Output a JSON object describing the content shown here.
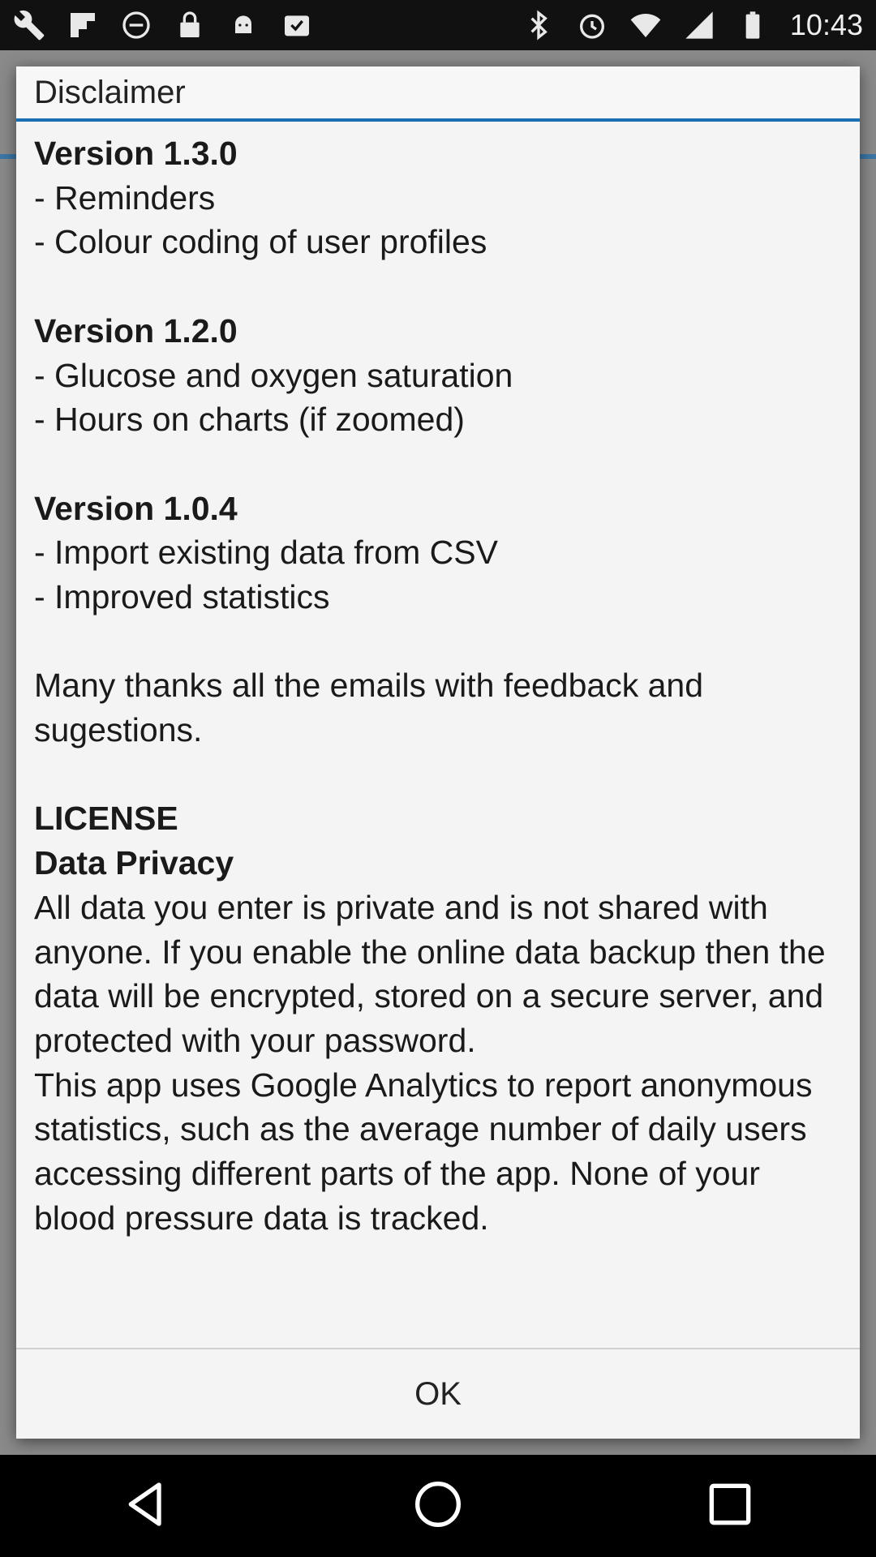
{
  "status_bar": {
    "icons_left": [
      "wrench-icon",
      "flipboard-icon",
      "dnd-icon",
      "lock-icon",
      "android-icon",
      "checklist-icon"
    ],
    "icons_right": [
      "bluetooth-icon",
      "alarm-icon",
      "wifi-icon",
      "signal-icon",
      "battery-icon"
    ],
    "time": "10:43"
  },
  "dialog": {
    "title": "Disclaimer",
    "sections": {
      "v130_heading": "Version 1.3.0",
      "v130_items": [
        "- Reminders",
        "- Colour coding of user profiles"
      ],
      "v120_heading": "Version 1.2.0",
      "v120_items": [
        "- Glucose and oxygen saturation",
        "- Hours on charts (if zoomed)"
      ],
      "v104_heading": "Version 1.0.4",
      "v104_items": [
        "- Import existing data from CSV",
        "- Improved statistics"
      ],
      "thanks": "Many thanks all the emails with feedback and sugestions.",
      "license_heading": "LICENSE",
      "privacy_heading": "Data Privacy",
      "privacy_text_1": "All data you enter is private and is not shared with anyone. If you enable the online data backup then the data will be encrypted, stored on a secure server, and protected with your password.",
      "privacy_text_2": "This app uses Google Analytics to report anonymous statistics, such as the average number of daily users accessing different parts of the app. None of your blood pressure data is tracked."
    },
    "ok_label": "OK"
  },
  "nav_bar": {
    "buttons": [
      "back-icon",
      "home-icon",
      "recents-icon"
    ]
  },
  "colors": {
    "accent": "#1a6fb3",
    "dialog_bg": "#f4f4f4",
    "scrim": "#8a8a8a"
  }
}
